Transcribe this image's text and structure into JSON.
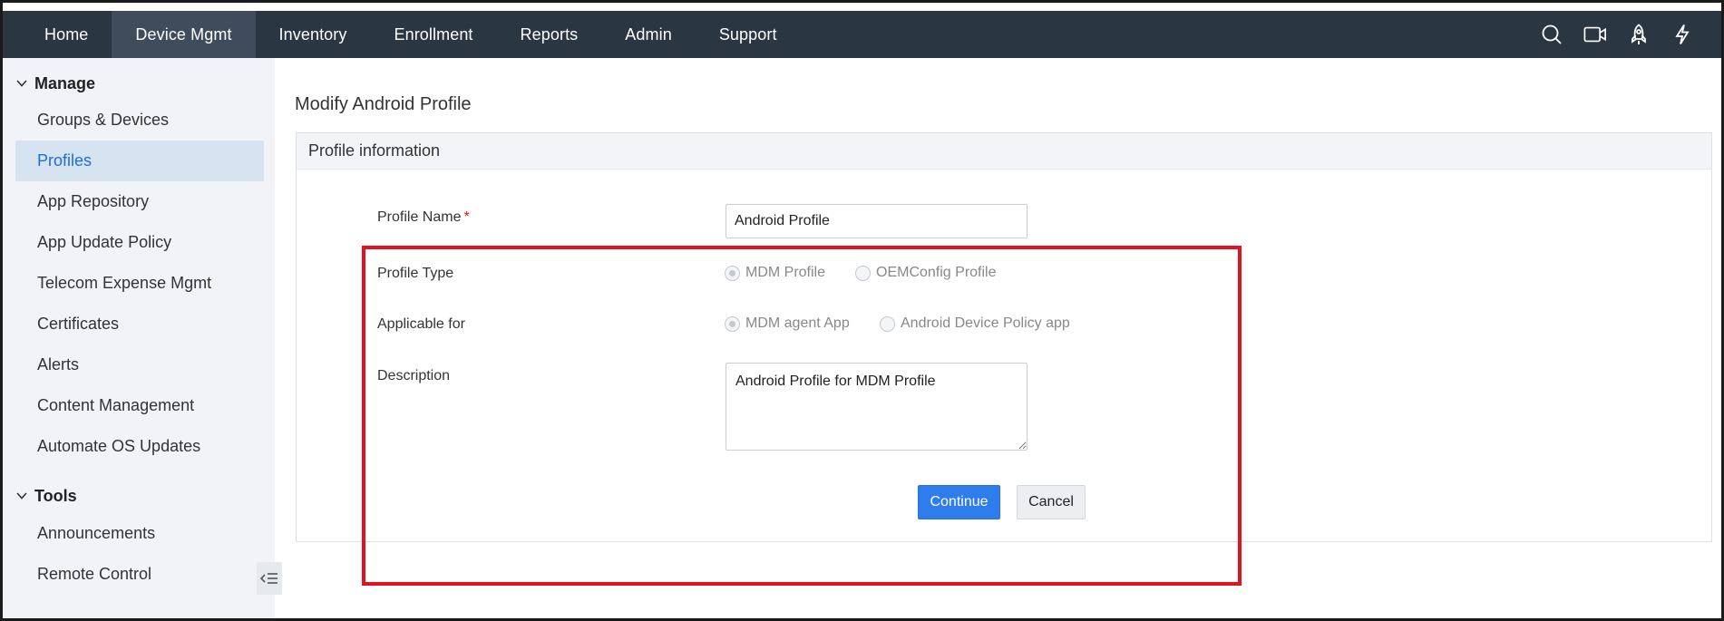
{
  "nav": {
    "items": [
      {
        "label": "Home"
      },
      {
        "label": "Device Mgmt",
        "active": true
      },
      {
        "label": "Inventory"
      },
      {
        "label": "Enrollment"
      },
      {
        "label": "Reports"
      },
      {
        "label": "Admin"
      },
      {
        "label": "Support"
      }
    ],
    "icons": [
      "search-icon",
      "video-icon",
      "rocket-icon",
      "lightning-icon"
    ]
  },
  "sidebar": {
    "manage": {
      "heading": "Manage",
      "items": [
        {
          "label": "Groups & Devices"
        },
        {
          "label": "Profiles",
          "active": true
        },
        {
          "label": "App Repository"
        },
        {
          "label": "App Update Policy"
        },
        {
          "label": "Telecom Expense Mgmt"
        },
        {
          "label": "Certificates"
        },
        {
          "label": "Alerts"
        },
        {
          "label": "Content Management"
        },
        {
          "label": "Automate OS Updates"
        }
      ]
    },
    "tools": {
      "heading": "Tools",
      "items": [
        {
          "label": "Announcements"
        },
        {
          "label": "Remote Control"
        }
      ]
    }
  },
  "main": {
    "title": "Modify Android Profile",
    "panel_title": "Profile information",
    "form": {
      "profile_name": {
        "label": "Profile Name",
        "required_mark": "*",
        "value": "Android Profile"
      },
      "profile_type": {
        "label": "Profile Type",
        "options": [
          {
            "label": "MDM Profile",
            "checked": true
          },
          {
            "label": "OEMConfig Profile",
            "checked": false
          }
        ]
      },
      "applicable_for": {
        "label": "Applicable for",
        "options": [
          {
            "label": "MDM agent App",
            "checked": true
          },
          {
            "label": "Android Device Policy app",
            "checked": false
          }
        ]
      },
      "description": {
        "label": "Description",
        "value": "Android Profile for MDM Profile"
      }
    },
    "buttons": {
      "continue": "Continue",
      "cancel": "Cancel"
    }
  },
  "colors": {
    "topbar": "#2b3643",
    "nav_active": "#3f4c5b",
    "sidebar_bg": "#f1f3f6",
    "sidebar_active_bg": "#d6e3f0",
    "sidebar_active_text": "#1f6ed4",
    "primary_button": "#2f7ded",
    "highlight_border": "#e3121e"
  }
}
